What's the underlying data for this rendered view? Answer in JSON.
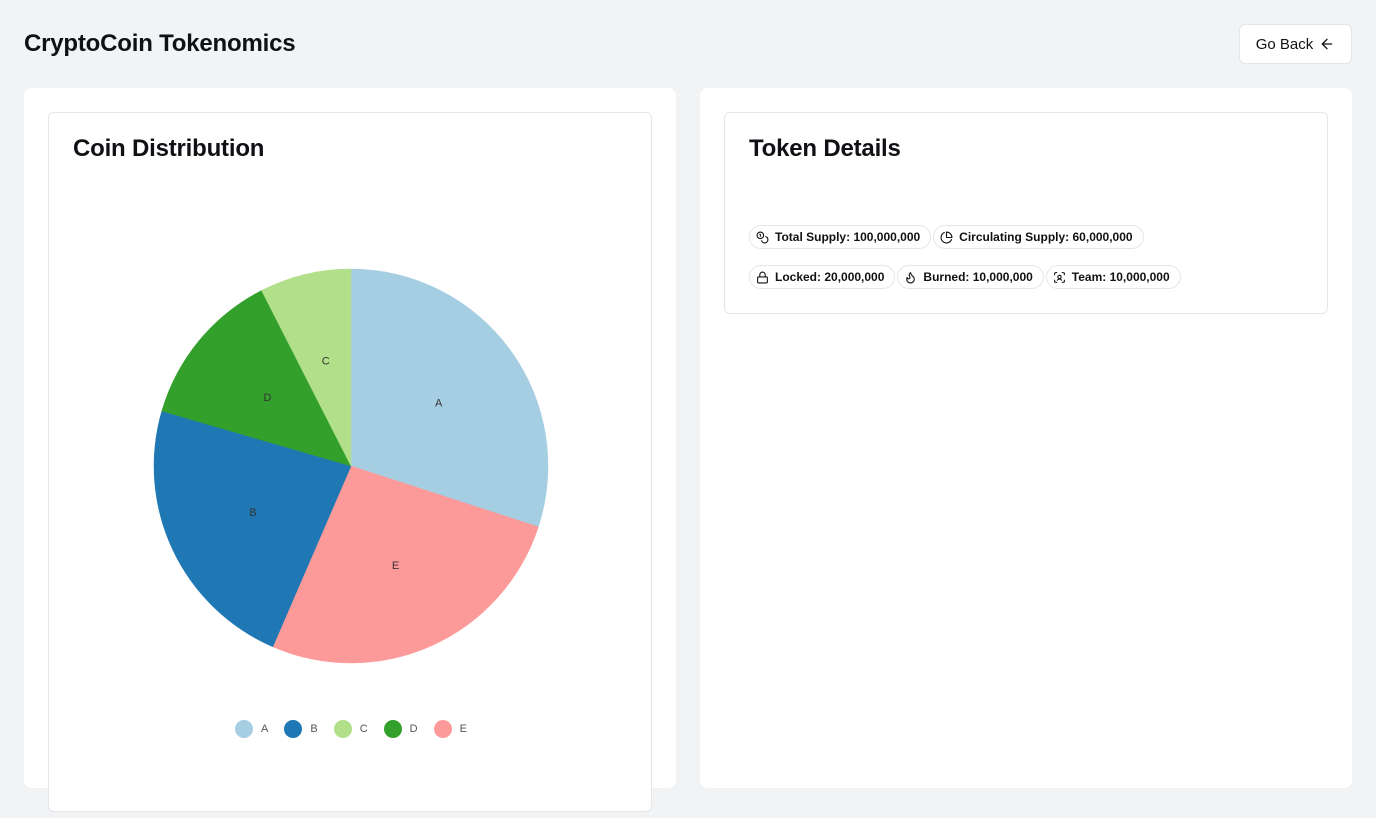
{
  "header": {
    "title": "CryptoCoin Tokenomics",
    "go_back_label": "Go Back",
    "go_back_icon": "arrow-left-icon"
  },
  "distribution": {
    "title": "Coin Distribution"
  },
  "details": {
    "title": "Token Details",
    "badges": [
      {
        "icon": "coins-icon",
        "label": "Total Supply: 100,000,000"
      },
      {
        "icon": "pie-chart-icon",
        "label": "Circulating Supply: 60,000,000"
      },
      {
        "icon": "lock-icon",
        "label": "Locked: 20,000,000"
      },
      {
        "icon": "flame-icon",
        "label": "Burned: 10,000,000"
      },
      {
        "icon": "scan-face-icon",
        "label": "Team: 10,000,000"
      }
    ]
  },
  "chart_data": {
    "type": "pie",
    "categories": [
      "A",
      "B",
      "C",
      "D",
      "E"
    ],
    "values": [
      30,
      23,
      7.5,
      13,
      26.5
    ],
    "colors": [
      "#a6cee3",
      "#1f78b4",
      "#b2df8a",
      "#33a02c",
      "#fb9a99"
    ],
    "order_clockwise_from_top": [
      "A",
      "E",
      "B",
      "D",
      "C"
    ],
    "legend_placement": "bottom"
  }
}
